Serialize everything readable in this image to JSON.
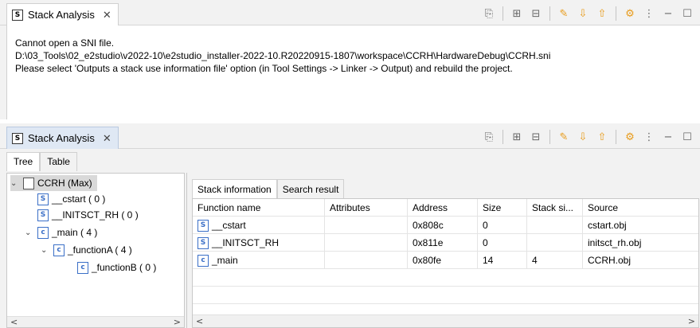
{
  "panel1": {
    "tab_title": "Stack Analysis",
    "tab_close": "✕",
    "messages": [
      "Cannot open a SNI file.",
      "D:\\03_Tools\\02_e2studio\\v2022-10\\e2studio_installer-2022-10.R20220915-1807\\workspace\\CCRH\\HardwareDebug\\CCRH.sni",
      "Please select 'Outputs a stack use information file' option (in Tool Settings -> Linker -> Output) and rebuild the project."
    ]
  },
  "panel2": {
    "tab_title": "Stack Analysis",
    "tab_close": "✕",
    "subtabs": [
      "Tree",
      "Table"
    ],
    "tree": [
      {
        "label": "CCRH (Max)",
        "icon": "file-icon"
      },
      {
        "label": "__cstart ( 0 )",
        "icon": "s-file-icon"
      },
      {
        "label": "__INITSCT_RH ( 0 )",
        "icon": "s-file-icon"
      },
      {
        "label": "_main ( 4 )",
        "icon": "c-file-icon"
      },
      {
        "label": "_functionA ( 4 )",
        "icon": "c-file-icon"
      },
      {
        "label": "_functionB ( 0 )",
        "icon": "c-file-icon"
      }
    ],
    "right_tabs": [
      "Stack information",
      "Search result"
    ],
    "columns": [
      "Function name",
      "Attributes",
      "Address",
      "Size",
      "Stack si...",
      "Source"
    ],
    "rows": [
      {
        "name": "__cstart",
        "attributes": "",
        "address": "0x808c",
        "size": "0",
        "stack": "",
        "source": "cstart.obj",
        "icon": "s-file-icon"
      },
      {
        "name": "__INITSCT_RH",
        "attributes": "",
        "address": "0x811e",
        "size": "0",
        "stack": "",
        "source": "initsct_rh.obj",
        "icon": "s-file-icon"
      },
      {
        "name": "_main",
        "attributes": "",
        "address": "0x80fe",
        "size": "14",
        "stack": "4",
        "source": "CCRH.obj",
        "icon": "c-file-icon"
      }
    ]
  },
  "toolbar_icons": [
    "export-icon",
    "expand-all-icon",
    "collapse-all-icon",
    "pen-icon",
    "arrow-down-icon",
    "arrow-up-icon",
    "settings-icon",
    "view-menu-icon",
    "minimize-icon",
    "maximize-icon"
  ],
  "glyphs": {
    "s": "S",
    "c": "c",
    "vt": "S",
    "expanded": "⌄",
    "left": "<",
    "right": ">"
  }
}
